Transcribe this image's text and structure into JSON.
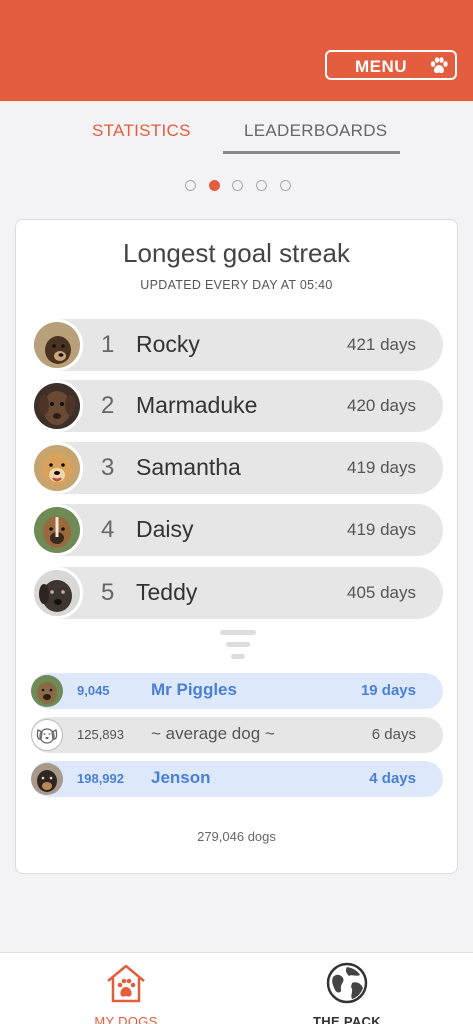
{
  "header": {
    "menu_label": "MENU",
    "menu_icon": "paw-icon"
  },
  "tabs": [
    {
      "label": "STATISTICS",
      "active": true
    },
    {
      "label": "LEADERBOARDS",
      "active": false
    }
  ],
  "pager": {
    "count": 5,
    "active_index": 1
  },
  "card": {
    "title": "Longest goal streak",
    "subtitle": "UPDATED EVERY DAY AT 05:40",
    "leaders": [
      {
        "rank": "1",
        "name": "Rocky",
        "value": "421 days"
      },
      {
        "rank": "2",
        "name": "Marmaduke",
        "value": "420 days"
      },
      {
        "rank": "3",
        "name": "Samantha",
        "value": "419 days"
      },
      {
        "rank": "4",
        "name": "Daisy",
        "value": "419 days"
      },
      {
        "rank": "5",
        "name": "Teddy",
        "value": "405 days"
      }
    ],
    "my_dogs": [
      {
        "position": "9,045",
        "name": "Mr Piggles",
        "value": "19 days",
        "highlight": true
      },
      {
        "position": "125,893",
        "name": "~ average dog ~",
        "value": "6 days",
        "highlight": false
      },
      {
        "position": "198,992",
        "name": "Jenson",
        "value": "4 days",
        "highlight": true
      }
    ],
    "total": "279,046 dogs"
  },
  "bottom_nav": [
    {
      "label": "MY DOGS",
      "icon": "dog-house-icon",
      "active": true
    },
    {
      "label": "THE PACK",
      "icon": "globe-icon",
      "active": false
    }
  ],
  "colors": {
    "brand": "#e35d3e",
    "highlight_blue": "#4a7fd6",
    "highlight_bg": "#dde9fb"
  }
}
